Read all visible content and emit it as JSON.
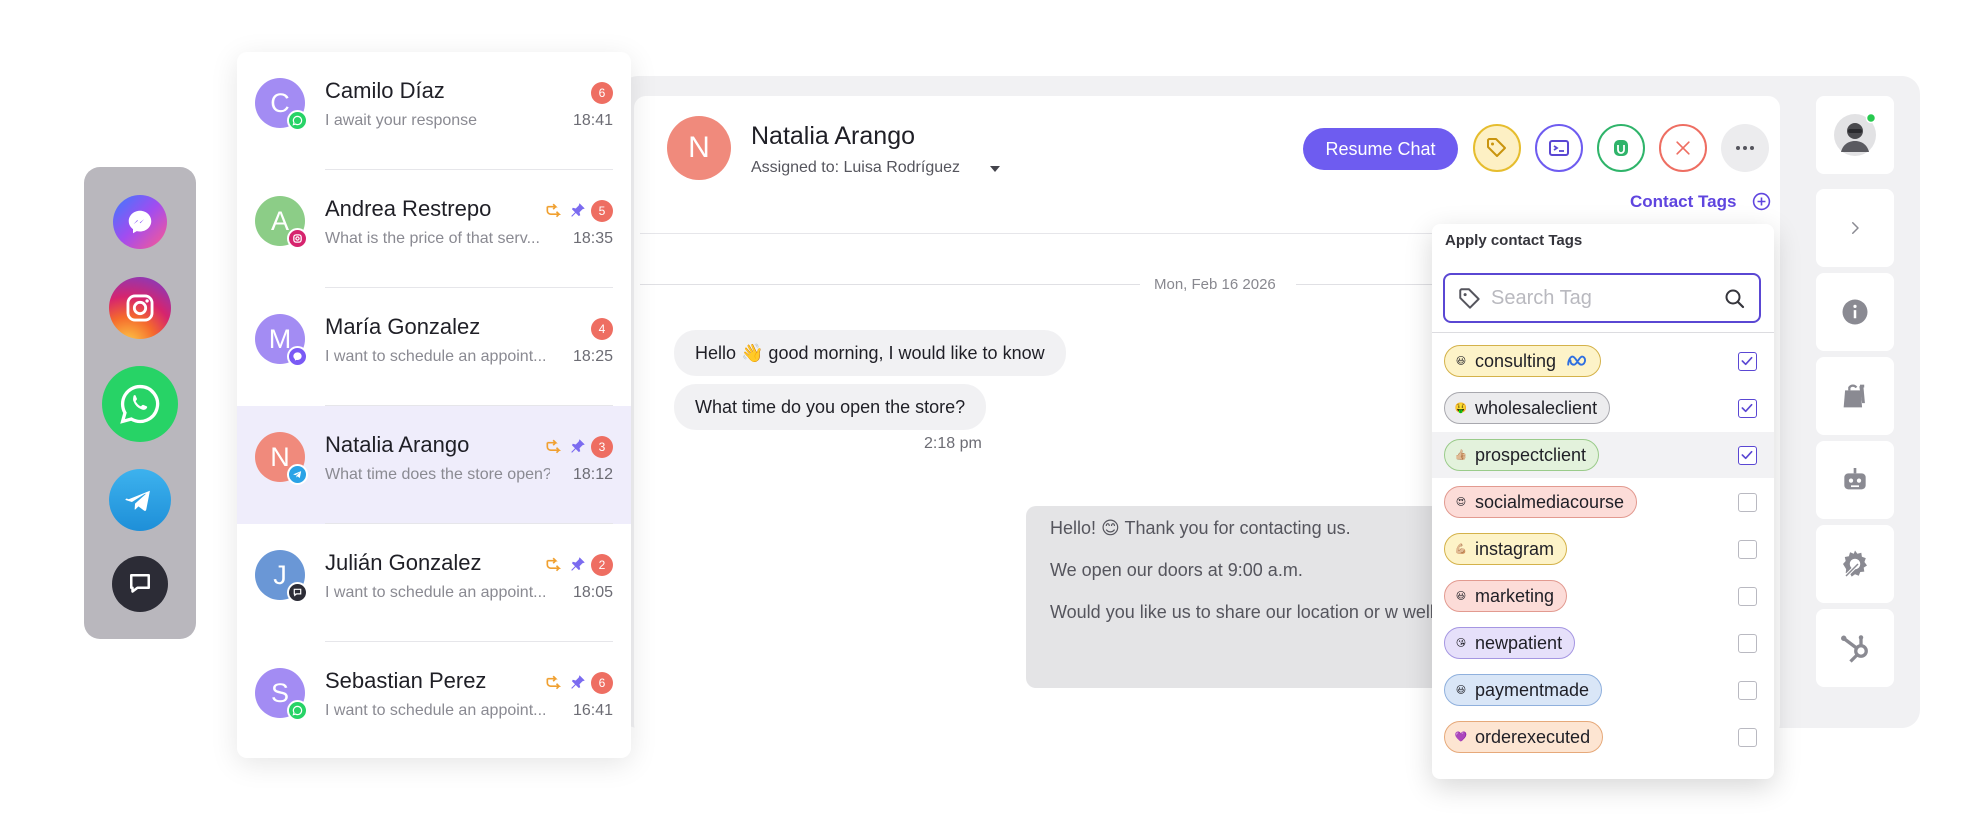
{
  "conversations": [
    {
      "initial": "C",
      "name": "Camilo Díaz",
      "preview": "I await your response",
      "time": "18:41",
      "badge": "6",
      "color": "#a38cf3",
      "channel": "whatsapp",
      "reply": false,
      "pin": false,
      "active": false
    },
    {
      "initial": "A",
      "name": "Andrea Restrepo",
      "preview": "What is the price of that serv...",
      "time": "18:35",
      "badge": "5",
      "color": "#8ccd87",
      "channel": "instagram",
      "reply": true,
      "pin": true,
      "active": false
    },
    {
      "initial": "M",
      "name": "María Gonzalez",
      "preview": "I want to schedule an appoint...",
      "time": "18:25",
      "badge": "4",
      "color": "#a38cf3",
      "channel": "messenger",
      "reply": false,
      "pin": false,
      "active": false
    },
    {
      "initial": "N",
      "name": "Natalia Arango",
      "preview": "What time does the store open?",
      "time": "18:12",
      "badge": "3",
      "color": "#f08a7c",
      "channel": "telegram",
      "reply": true,
      "pin": true,
      "active": true
    },
    {
      "initial": "J",
      "name": "Julián Gonzalez",
      "preview": "I want to schedule an appoint...",
      "time": "18:05",
      "badge": "2",
      "color": "#6a97d6",
      "channel": "webchat",
      "reply": true,
      "pin": true,
      "active": false
    },
    {
      "initial": "S",
      "name": "Sebastian Perez",
      "preview": "I want to schedule an appoint...",
      "time": "16:41",
      "badge": "6",
      "color": "#a38cf3",
      "channel": "whatsapp",
      "reply": true,
      "pin": true,
      "active": false
    }
  ],
  "channels": [
    "messenger-icon",
    "instagram-icon",
    "whatsapp-icon",
    "telegram-icon",
    "webchat-icon"
  ],
  "header": {
    "initial": "N",
    "name": "Natalia Arango",
    "assigned": "Assigned to: Luisa Rodríguez",
    "resume_label": "Resume Chat",
    "contact_tags_label": "Contact Tags"
  },
  "messages": {
    "date": "Mon, Feb 16 2026",
    "incoming": [
      "Hello 👋 good morning, I would like to know",
      "What time do you open the store?"
    ],
    "incoming_time": "2:18 pm",
    "outgoing": [
      "Hello! 😊 Thank you for contacting us.",
      "We open our doors at 9:00 a.m.",
      "Would you like us to share our location or w well?"
    ]
  },
  "tag_popup": {
    "title": "Apply contact Tags",
    "search_placeholder": "Search Tag",
    "tags": [
      {
        "label": "consulting",
        "bg": "#fdf3c8",
        "border": "#d4b24a",
        "emoji": "😃",
        "checked": true,
        "meta": true
      },
      {
        "label": "wholesaleclient",
        "bg": "#ececee",
        "border": "#a8a8ae",
        "emoji": "🤑",
        "checked": true,
        "meta": false
      },
      {
        "label": "prospectclient",
        "bg": "#e3f2dc",
        "border": "#9acb8a",
        "emoji": "👍🏼",
        "checked": true,
        "meta": false
      },
      {
        "label": "socialmediacourse",
        "bg": "#fcdcd8",
        "border": "#e29a90",
        "emoji": "😍",
        "checked": false,
        "meta": false
      },
      {
        "label": "instagram",
        "bg": "#fdf3c8",
        "border": "#d4b24a",
        "emoji": "💪🏼",
        "checked": false,
        "meta": false
      },
      {
        "label": "marketing",
        "bg": "#fcdcd8",
        "border": "#e29a90",
        "emoji": "😃",
        "checked": false,
        "meta": false
      },
      {
        "label": "newpatient",
        "bg": "#e6e0fa",
        "border": "#a596e2",
        "emoji": "😘",
        "checked": false,
        "meta": false
      },
      {
        "label": "paymentmade",
        "bg": "#d9e6f7",
        "border": "#8fb0dd",
        "emoji": "😃",
        "checked": false,
        "meta": false
      },
      {
        "label": "orderexecuted",
        "bg": "#fde5d2",
        "border": "#e6a97a",
        "emoji": "💜",
        "checked": false,
        "meta": false
      }
    ]
  },
  "rail": [
    "user-avatar",
    "chevron-right-icon",
    "info-icon",
    "shopping-bag-icon",
    "bot-icon",
    "settings-gear-icon",
    "hubspot-icon"
  ],
  "colors": {
    "accent": "#6e5cf0",
    "badge": "#ee6e62",
    "reply": "#f0a030",
    "pin": "#7b6bf0"
  }
}
